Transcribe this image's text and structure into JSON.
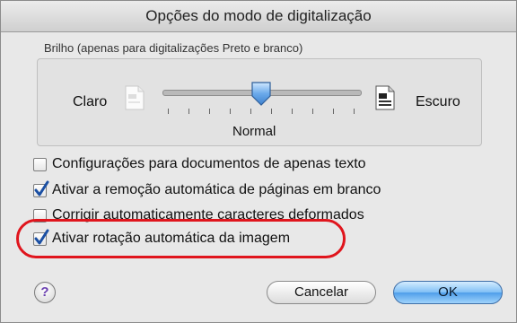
{
  "window": {
    "title": "Opções do modo de digitalização"
  },
  "brightness": {
    "group_label": "Brilho (apenas para digitalizações Preto e branco)",
    "left_label": "Claro",
    "right_label": "Escuro",
    "value_label": "Normal",
    "level": 0.5
  },
  "options": [
    {
      "label": "Configurações para documentos de apenas texto",
      "checked": false
    },
    {
      "label": "Ativar a remoção automática de páginas em branco",
      "checked": true
    },
    {
      "label": "Corrigir automaticamente caracteres deformados",
      "checked": false
    },
    {
      "label": "Ativar rotação automática da imagem",
      "checked": true
    }
  ],
  "buttons": {
    "help": "?",
    "cancel": "Cancelar",
    "ok": "OK"
  },
  "colors": {
    "highlight": "#e0151d",
    "checkmark": "#1a4fa3",
    "ok_button": "#4f9eea"
  }
}
